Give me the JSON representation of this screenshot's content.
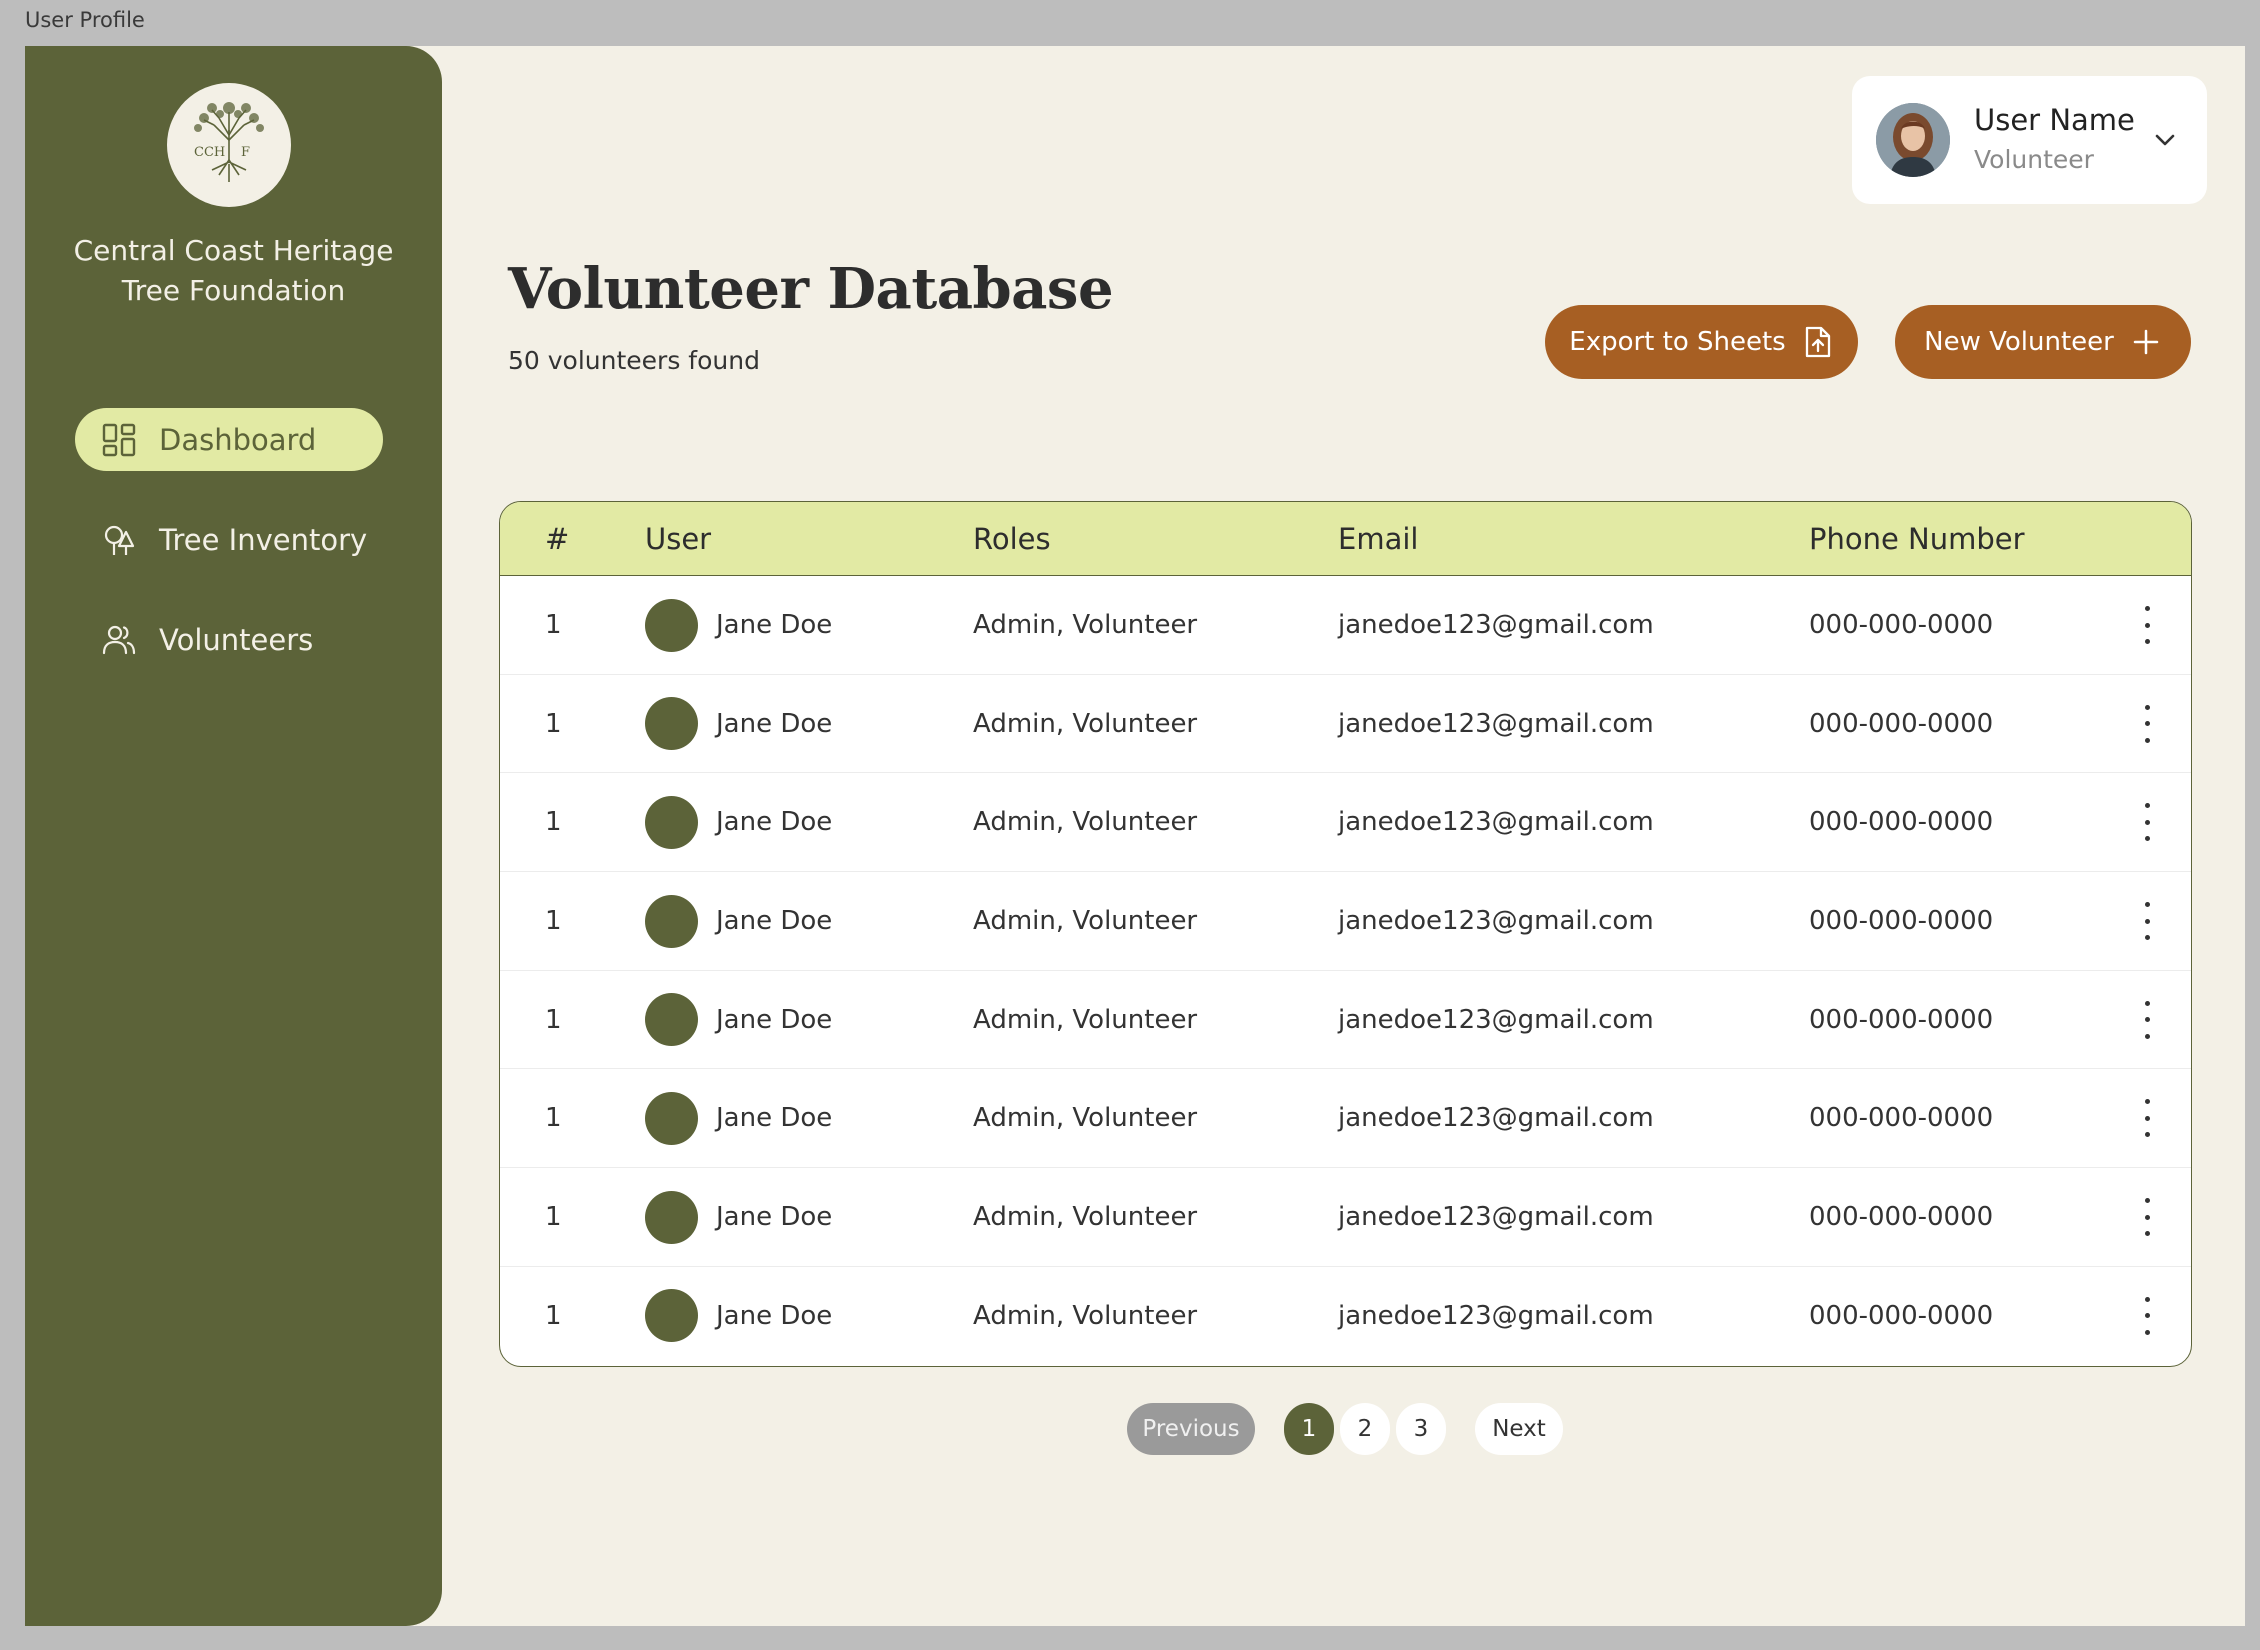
{
  "window": {
    "title": "User Profile"
  },
  "sidebar": {
    "logo_text": "CCH F",
    "org_name_line1": "Central Coast Heritage",
    "org_name_line2": "Tree Foundation",
    "items": [
      {
        "label": "Dashboard",
        "icon": "dashboard-icon",
        "active": true
      },
      {
        "label": "Tree Inventory",
        "icon": "tree-icon",
        "active": false
      },
      {
        "label": "Volunteers",
        "icon": "users-icon",
        "active": false
      }
    ]
  },
  "user": {
    "name": "User Name",
    "role": "Volunteer"
  },
  "header": {
    "title": "Volunteer Database",
    "count_text": "50 volunteers found",
    "export_label": "Export to Sheets",
    "new_label": "New Volunteer"
  },
  "table": {
    "columns": [
      "#",
      "User",
      "Roles",
      "Email",
      "Phone Number"
    ],
    "rows": [
      {
        "num": "1",
        "name": "Jane Doe",
        "roles": "Admin, Volunteer",
        "email": "janedoe123@gmail.com",
        "phone": "000-000-0000"
      },
      {
        "num": "1",
        "name": "Jane Doe",
        "roles": "Admin, Volunteer",
        "email": "janedoe123@gmail.com",
        "phone": "000-000-0000"
      },
      {
        "num": "1",
        "name": "Jane Doe",
        "roles": "Admin, Volunteer",
        "email": "janedoe123@gmail.com",
        "phone": "000-000-0000"
      },
      {
        "num": "1",
        "name": "Jane Doe",
        "roles": "Admin, Volunteer",
        "email": "janedoe123@gmail.com",
        "phone": "000-000-0000"
      },
      {
        "num": "1",
        "name": "Jane Doe",
        "roles": "Admin, Volunteer",
        "email": "janedoe123@gmail.com",
        "phone": "000-000-0000"
      },
      {
        "num": "1",
        "name": "Jane Doe",
        "roles": "Admin, Volunteer",
        "email": "janedoe123@gmail.com",
        "phone": "000-000-0000"
      },
      {
        "num": "1",
        "name": "Jane Doe",
        "roles": "Admin, Volunteer",
        "email": "janedoe123@gmail.com",
        "phone": "000-000-0000"
      },
      {
        "num": "1",
        "name": "Jane Doe",
        "roles": "Admin, Volunteer",
        "email": "janedoe123@gmail.com",
        "phone": "000-000-0000"
      }
    ]
  },
  "pagination": {
    "previous": "Previous",
    "next": "Next",
    "pages": [
      "1",
      "2",
      "3"
    ],
    "current": "1"
  },
  "colors": {
    "sidebar": "#5c6339",
    "accent_button": "#a75f23",
    "highlight": "#e2eaa4",
    "background": "#f3f0e6"
  }
}
